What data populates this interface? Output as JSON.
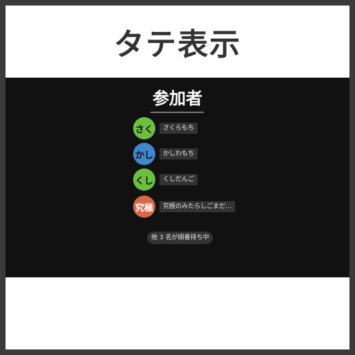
{
  "page_title": "タテ表示",
  "panel": {
    "heading": "参加者",
    "participants": [
      {
        "avatar_text": "さく",
        "name": "さくらもち",
        "avatar_color": "#6cbf3f"
      },
      {
        "avatar_text": "かし",
        "name": "かしわもち",
        "avatar_color": "#3f87cf"
      },
      {
        "avatar_text": "くし",
        "name": "くしだんご",
        "avatar_color": "#6cbf3f"
      },
      {
        "avatar_text": "究極",
        "name": "究極のみたらしごまだ…",
        "avatar_color": "#d8664a"
      }
    ],
    "waiting_text": "他 3 名が順番待ち中"
  }
}
